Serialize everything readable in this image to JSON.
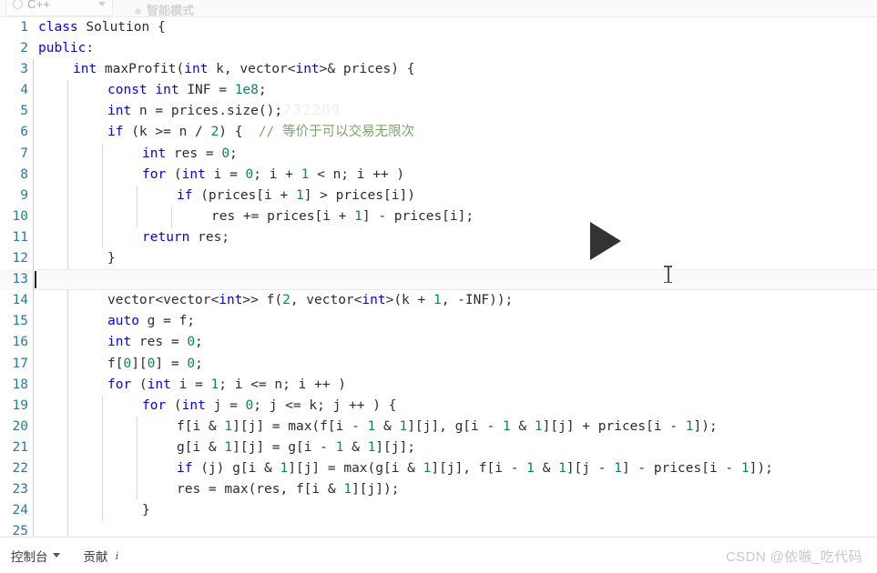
{
  "topbar": {
    "language_label": "C++",
    "language_icon": "globe-icon",
    "chevron_icon": "chevron-down-icon",
    "mode_label": "智能模式",
    "mode_dot_icon": "status-dot-icon"
  },
  "editor": {
    "active_line": 13,
    "caret_line": 13,
    "background_watermark": "1732269",
    "lines": [
      {
        "n": "1",
        "indent": 0,
        "guides": 0,
        "tokens": [
          {
            "t": "kw",
            "s": "class"
          },
          {
            "t": "pln",
            "s": " Solution {"
          }
        ]
      },
      {
        "n": "2",
        "indent": 0,
        "guides": 0,
        "tokens": [
          {
            "t": "kw",
            "s": "public"
          },
          {
            "t": "pln",
            "s": ":"
          }
        ]
      },
      {
        "n": "3",
        "indent": 1,
        "guides": 1,
        "tokens": [
          {
            "t": "kw",
            "s": "int"
          },
          {
            "t": "pln",
            "s": " maxProfit("
          },
          {
            "t": "kw",
            "s": "int"
          },
          {
            "t": "pln",
            "s": " k, vector<"
          },
          {
            "t": "kw",
            "s": "int"
          },
          {
            "t": "pln",
            "s": ">& prices) {"
          }
        ]
      },
      {
        "n": "4",
        "indent": 2,
        "guides": 2,
        "tokens": [
          {
            "t": "kw",
            "s": "const"
          },
          {
            "t": "pln",
            "s": " "
          },
          {
            "t": "kw",
            "s": "int"
          },
          {
            "t": "pln",
            "s": " INF = "
          },
          {
            "t": "num",
            "s": "1e8"
          },
          {
            "t": "pln",
            "s": ";"
          }
        ]
      },
      {
        "n": "5",
        "indent": 2,
        "guides": 2,
        "tokens": [
          {
            "t": "kw",
            "s": "int"
          },
          {
            "t": "pln",
            "s": " n = prices.size();"
          }
        ]
      },
      {
        "n": "6",
        "indent": 2,
        "guides": 2,
        "tokens": [
          {
            "t": "kw",
            "s": "if"
          },
          {
            "t": "pln",
            "s": " (k >= n / "
          },
          {
            "t": "num",
            "s": "2"
          },
          {
            "t": "pln",
            "s": ") {  "
          },
          {
            "t": "cmt",
            "s": "// 等价于可以交易无限次"
          }
        ]
      },
      {
        "n": "7",
        "indent": 3,
        "guides": 3,
        "tokens": [
          {
            "t": "kw",
            "s": "int"
          },
          {
            "t": "pln",
            "s": " res = "
          },
          {
            "t": "num",
            "s": "0"
          },
          {
            "t": "pln",
            "s": ";"
          }
        ]
      },
      {
        "n": "8",
        "indent": 3,
        "guides": 3,
        "tokens": [
          {
            "t": "kw",
            "s": "for"
          },
          {
            "t": "pln",
            "s": " ("
          },
          {
            "t": "kw",
            "s": "int"
          },
          {
            "t": "pln",
            "s": " i = "
          },
          {
            "t": "num",
            "s": "0"
          },
          {
            "t": "pln",
            "s": "; i + "
          },
          {
            "t": "num",
            "s": "1"
          },
          {
            "t": "pln",
            "s": " < n; i ++ )"
          }
        ]
      },
      {
        "n": "9",
        "indent": 4,
        "guides": 4,
        "tokens": [
          {
            "t": "kw",
            "s": "if"
          },
          {
            "t": "pln",
            "s": " (prices[i + "
          },
          {
            "t": "num",
            "s": "1"
          },
          {
            "t": "pln",
            "s": "] > prices[i])"
          }
        ]
      },
      {
        "n": "10",
        "indent": 5,
        "guides": 5,
        "tokens": [
          {
            "t": "pln",
            "s": "res += prices[i + "
          },
          {
            "t": "num",
            "s": "1"
          },
          {
            "t": "pln",
            "s": "] - prices[i];"
          }
        ]
      },
      {
        "n": "11",
        "indent": 3,
        "guides": 3,
        "tokens": [
          {
            "t": "kw",
            "s": "return"
          },
          {
            "t": "pln",
            "s": " res;"
          }
        ]
      },
      {
        "n": "12",
        "indent": 2,
        "guides": 2,
        "tokens": [
          {
            "t": "pln",
            "s": "}"
          }
        ]
      },
      {
        "n": "13",
        "indent": 0,
        "guides": 1,
        "tokens": []
      },
      {
        "n": "14",
        "indent": 2,
        "guides": 2,
        "tokens": [
          {
            "t": "pln",
            "s": "vector<vector<"
          },
          {
            "t": "kw",
            "s": "int"
          },
          {
            "t": "pln",
            "s": ">> f("
          },
          {
            "t": "num",
            "s": "2"
          },
          {
            "t": "pln",
            "s": ", vector<"
          },
          {
            "t": "kw",
            "s": "int"
          },
          {
            "t": "pln",
            "s": ">(k + "
          },
          {
            "t": "num",
            "s": "1"
          },
          {
            "t": "pln",
            "s": ", -INF));"
          }
        ]
      },
      {
        "n": "15",
        "indent": 2,
        "guides": 2,
        "tokens": [
          {
            "t": "kw",
            "s": "auto"
          },
          {
            "t": "pln",
            "s": " g = f;"
          }
        ]
      },
      {
        "n": "16",
        "indent": 2,
        "guides": 2,
        "tokens": [
          {
            "t": "kw",
            "s": "int"
          },
          {
            "t": "pln",
            "s": " res = "
          },
          {
            "t": "num",
            "s": "0"
          },
          {
            "t": "pln",
            "s": ";"
          }
        ]
      },
      {
        "n": "17",
        "indent": 2,
        "guides": 2,
        "tokens": [
          {
            "t": "pln",
            "s": "f["
          },
          {
            "t": "num",
            "s": "0"
          },
          {
            "t": "pln",
            "s": "]["
          },
          {
            "t": "num",
            "s": "0"
          },
          {
            "t": "pln",
            "s": "] = "
          },
          {
            "t": "num",
            "s": "0"
          },
          {
            "t": "pln",
            "s": ";"
          }
        ]
      },
      {
        "n": "18",
        "indent": 2,
        "guides": 2,
        "tokens": [
          {
            "t": "kw",
            "s": "for"
          },
          {
            "t": "pln",
            "s": " ("
          },
          {
            "t": "kw",
            "s": "int"
          },
          {
            "t": "pln",
            "s": " i = "
          },
          {
            "t": "num",
            "s": "1"
          },
          {
            "t": "pln",
            "s": "; i <= n; i ++ )"
          }
        ]
      },
      {
        "n": "19",
        "indent": 3,
        "guides": 3,
        "tokens": [
          {
            "t": "kw",
            "s": "for"
          },
          {
            "t": "pln",
            "s": " ("
          },
          {
            "t": "kw",
            "s": "int"
          },
          {
            "t": "pln",
            "s": " j = "
          },
          {
            "t": "num",
            "s": "0"
          },
          {
            "t": "pln",
            "s": "; j <= k; j ++ ) {"
          }
        ]
      },
      {
        "n": "20",
        "indent": 4,
        "guides": 4,
        "tokens": [
          {
            "t": "pln",
            "s": "f[i & "
          },
          {
            "t": "num",
            "s": "1"
          },
          {
            "t": "pln",
            "s": "][j] = max(f[i - "
          },
          {
            "t": "num",
            "s": "1"
          },
          {
            "t": "pln",
            "s": " & "
          },
          {
            "t": "num",
            "s": "1"
          },
          {
            "t": "pln",
            "s": "][j], g[i - "
          },
          {
            "t": "num",
            "s": "1"
          },
          {
            "t": "pln",
            "s": " & "
          },
          {
            "t": "num",
            "s": "1"
          },
          {
            "t": "pln",
            "s": "][j] + prices[i - "
          },
          {
            "t": "num",
            "s": "1"
          },
          {
            "t": "pln",
            "s": "]);"
          }
        ]
      },
      {
        "n": "21",
        "indent": 4,
        "guides": 4,
        "tokens": [
          {
            "t": "pln",
            "s": "g[i & "
          },
          {
            "t": "num",
            "s": "1"
          },
          {
            "t": "pln",
            "s": "][j] = g[i - "
          },
          {
            "t": "num",
            "s": "1"
          },
          {
            "t": "pln",
            "s": " & "
          },
          {
            "t": "num",
            "s": "1"
          },
          {
            "t": "pln",
            "s": "][j];"
          }
        ]
      },
      {
        "n": "22",
        "indent": 4,
        "guides": 4,
        "tokens": [
          {
            "t": "kw",
            "s": "if"
          },
          {
            "t": "pln",
            "s": " (j) g[i & "
          },
          {
            "t": "num",
            "s": "1"
          },
          {
            "t": "pln",
            "s": "][j] = max(g[i & "
          },
          {
            "t": "num",
            "s": "1"
          },
          {
            "t": "pln",
            "s": "][j], f[i - "
          },
          {
            "t": "num",
            "s": "1"
          },
          {
            "t": "pln",
            "s": " & "
          },
          {
            "t": "num",
            "s": "1"
          },
          {
            "t": "pln",
            "s": "][j - "
          },
          {
            "t": "num",
            "s": "1"
          },
          {
            "t": "pln",
            "s": "] - prices[i - "
          },
          {
            "t": "num",
            "s": "1"
          },
          {
            "t": "pln",
            "s": "]);"
          }
        ]
      },
      {
        "n": "23",
        "indent": 4,
        "guides": 4,
        "tokens": [
          {
            "t": "pln",
            "s": "res = max(res, f[i & "
          },
          {
            "t": "num",
            "s": "1"
          },
          {
            "t": "pln",
            "s": "][j]);"
          }
        ]
      },
      {
        "n": "24",
        "indent": 3,
        "guides": 3,
        "tokens": [
          {
            "t": "pln",
            "s": "}"
          }
        ]
      },
      {
        "n": "25",
        "indent": 2,
        "guides": 2,
        "tokens": []
      }
    ]
  },
  "overlay": {
    "play_icon": "play-triangle-icon",
    "text_cursor_icon": "i-beam-cursor-icon"
  },
  "bottombar": {
    "console_label": "控制台",
    "console_caret_icon": "caret-down-icon",
    "contribute_label": "贡献",
    "contribute_info_icon": "info-italic-icon"
  },
  "watermark": {
    "text": "CSDN @依嗾_吃代码"
  }
}
